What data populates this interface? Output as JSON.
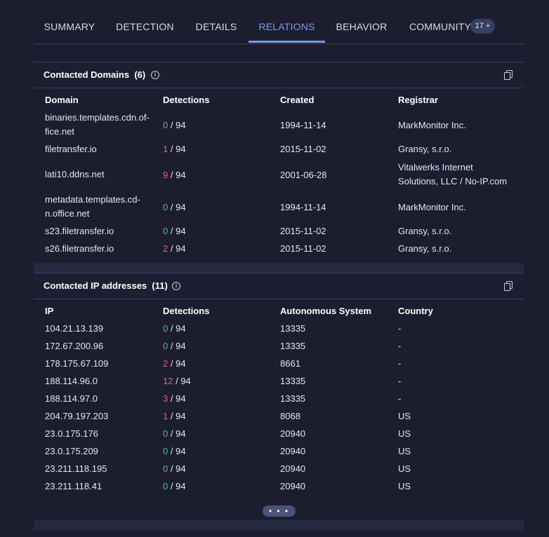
{
  "tabs": [
    {
      "label": "SUMMARY"
    },
    {
      "label": "DETECTION"
    },
    {
      "label": "DETAILS"
    },
    {
      "label": "RELATIONS"
    },
    {
      "label": "BEHAVIOR"
    },
    {
      "label": "COMMUNITY"
    }
  ],
  "active_tab": "RELATIONS",
  "community_badge": "17 +",
  "domains": {
    "title": "Contacted Domains",
    "count": "(6)",
    "headers": {
      "domain": "Domain",
      "detections": "Detections",
      "created": "Created",
      "registrar": "Registrar"
    },
    "rows": [
      {
        "domain": "binaries.templates.cdn.of-fice.net",
        "det": "0",
        "total": "/ 94",
        "created": "1994-11-14",
        "registrar": "MarkMonitor Inc."
      },
      {
        "domain": "filetransfer.io",
        "det": "1",
        "total": "/ 94",
        "created": "2015-11-02",
        "registrar": "Gransy, s.r.o."
      },
      {
        "domain": "lati10.ddns.net",
        "det": "9",
        "total": "/ 94",
        "created": "2001-06-28",
        "registrar": "Vitalwerks Internet Solutions, LLC / No-IP.com"
      },
      {
        "domain": "metadata.templates.cd-n.office.net",
        "det": "0",
        "total": "/ 94",
        "created": "1994-11-14",
        "registrar": "MarkMonitor Inc."
      },
      {
        "domain": "s23.filetransfer.io",
        "det": "0",
        "total": "/ 94",
        "created": "2015-11-02",
        "registrar": "Gransy, s.r.o."
      },
      {
        "domain": "s26.filetransfer.io",
        "det": "2",
        "total": "/ 94",
        "created": "2015-11-02",
        "registrar": "Gransy, s.r.o."
      }
    ]
  },
  "ips": {
    "title": "Contacted IP addresses",
    "count": "(11)",
    "headers": {
      "ip": "IP",
      "detections": "Detections",
      "as": "Autonomous System",
      "country": "Country"
    },
    "rows": [
      {
        "ip": "104.21.13.139",
        "det": "0",
        "total": "/ 94",
        "as": "13335",
        "country": "-"
      },
      {
        "ip": "172.67.200.96",
        "det": "0",
        "total": "/ 94",
        "as": "13335",
        "country": "-"
      },
      {
        "ip": "178.175.67.109",
        "det": "2",
        "total": "/ 94",
        "as": "8661",
        "country": "-"
      },
      {
        "ip": "188.114.96.0",
        "det": "12",
        "total": "/ 94",
        "as": "13335",
        "country": "-"
      },
      {
        "ip": "188.114.97.0",
        "det": "3",
        "total": "/ 94",
        "as": "13335",
        "country": "-"
      },
      {
        "ip": "204.79.197.203",
        "det": "1",
        "total": "/ 94",
        "as": "8068",
        "country": "US"
      },
      {
        "ip": "23.0.175.176",
        "det": "0",
        "total": "/ 94",
        "as": "20940",
        "country": "US"
      },
      {
        "ip": "23.0.175.209",
        "det": "0",
        "total": "/ 94",
        "as": "20940",
        "country": "US"
      },
      {
        "ip": "23.211.118.195",
        "det": "0",
        "total": "/ 94",
        "as": "20940",
        "country": "US"
      },
      {
        "ip": "23.211.118.41",
        "det": "0",
        "total": "/ 94",
        "as": "20940",
        "country": "US"
      }
    ]
  },
  "more_button": "• • •",
  "colors": {
    "background": "#1c1d2e",
    "accent": "#7f98f0",
    "detected": "#ee5f6a",
    "clean": "#59b8a3"
  }
}
